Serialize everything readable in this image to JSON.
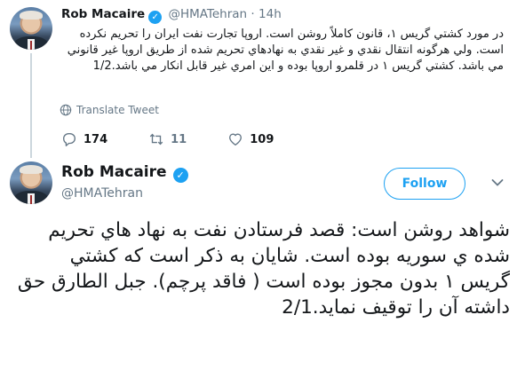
{
  "tweets": [
    {
      "author_name": "Rob Macaire",
      "handle": "@HMATehran",
      "separator": "·",
      "time": "14h",
      "text": "در مورد کشتي گريس ۱، قانون کاملاً روشن است. اروپا تجارت نفت ايران را تحريم نکرده است. ولي هرگونه انتقال نقدي و غير نقدي به نهادهاي تحريم شده از طريق اروپا غير قانوني مي باشد. کشتي گريس ۱ در قلمرو اروپا بوده و اين امري غير قابل انکار مي باشد.1/2",
      "translate_label": "Translate Tweet",
      "replies": "174",
      "retweets": "11",
      "likes": "109"
    },
    {
      "author_name": "Rob Macaire",
      "handle": "@HMATehran",
      "follow_label": "Follow",
      "text": "شواهد روشن است: قصد فرستادن نفت به نهاد هاي تحريم شده ي سوريه بوده است. شايان به ذکر است که کشتي گريس ۱ بدون مجوز بوده است ( فاقد پرچم). جبل الطارق حق داشته آن را توقيف نمايد.2/1"
    }
  ],
  "icons": {
    "verified": "verified-badge-icon",
    "translate": "globe-icon",
    "reply": "reply-icon",
    "retweet": "retweet-icon",
    "like": "heart-icon",
    "more": "chevron-down-icon"
  },
  "colors": {
    "accent": "#1da1f2",
    "text": "#14171a",
    "muted": "#657786",
    "thread_line": "#ccd6dd"
  }
}
